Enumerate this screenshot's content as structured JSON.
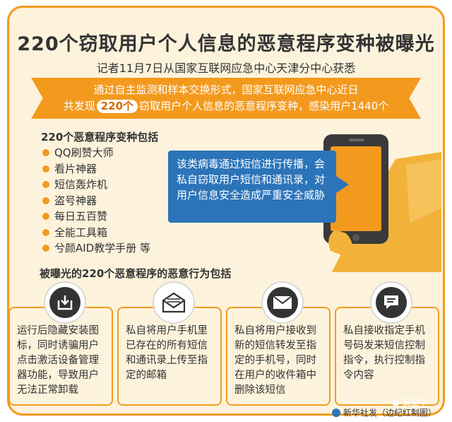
{
  "title": "220个窃取用户个人信息的恶意程序变种被曝光",
  "subtitle": "记者11月7日从国家互联网应急中心天津分中心获悉",
  "banner": {
    "line1": "通过自主监测和样本交换形式，国家互联网应急中心近日",
    "line2_prefix": "共发现",
    "count": "220个",
    "line2_suffix": "窃取用户个人信息的恶意程序变种，感染用户1440个"
  },
  "variants": {
    "title": "220个恶意程序变种包括",
    "items": [
      "QQ刷赞大师",
      "看片神器",
      "短信轰炸机",
      "盗号神器",
      "每日五百赞",
      "全能工具箱",
      "兮颜AID教学手册  等"
    ]
  },
  "bubble_text": "该类病毒通过短信进行传播，会私自窃取用户短信和通讯录，对用户信息安全造成严重安全威胁",
  "behaviors": {
    "title": "被曝光的220个恶意程序的恶意行为包括",
    "cards": [
      {
        "icon": "download-icon",
        "text": "运行后隐藏安装图标，同时诱骗用户点击激活设备管理器功能，导致用户无法正常卸载"
      },
      {
        "icon": "envelope-open-icon",
        "text": "私自将用户手机里已存在的所有短信和通讯录上传至指定的邮箱"
      },
      {
        "icon": "envelope-icon",
        "text": "私自将用户接收到新的短信转发至指定的手机号，同时在用户的收件箱中删除该短信"
      },
      {
        "icon": "chat-bubble-icon",
        "text": "私自接收指定手机号码发来短信控制指令，执行控制指令内容"
      }
    ]
  },
  "watermark": "安全牛",
  "credit": "新华社发（边纪红制图）",
  "colors": {
    "accent": "#f39a1e",
    "bubble": "#2c74ba",
    "background": "#fdf3dc"
  }
}
